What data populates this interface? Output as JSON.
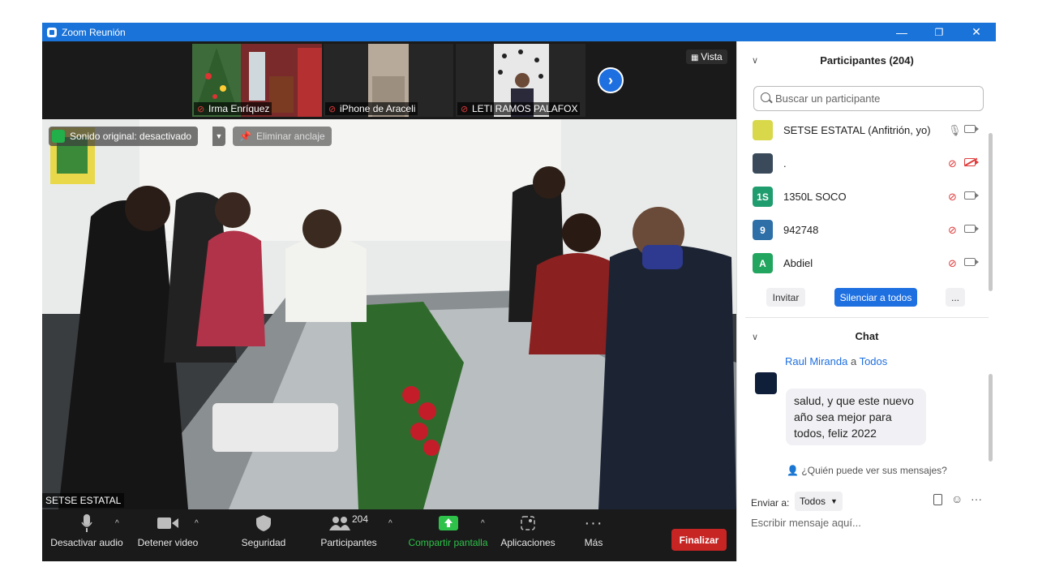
{
  "window": {
    "title": "Zoom Reunión",
    "minimize": "—",
    "restore": "❐",
    "close": "✕"
  },
  "gallery": {
    "tiles": [
      {
        "name": "Irma Enríquez"
      },
      {
        "name": "iPhone de Araceli"
      },
      {
        "name": "LETI RAMOS PALAFOX"
      }
    ],
    "view_label": "Vista"
  },
  "main_video": {
    "sound_label": "Sonido original: desactivado",
    "unpin_label": "Eliminar anclaje",
    "speaker_name": "SETSE ESTATAL"
  },
  "toolbar": {
    "mute_label": "Desactivar audio",
    "video_label": "Detener video",
    "security_label": "Seguridad",
    "participants_label": "Participantes",
    "participants_count": "204",
    "share_label": "Compartir pantalla",
    "apps_label": "Aplicaciones",
    "more_label": "Más",
    "end_label": "Finalizar"
  },
  "participants": {
    "title": "Participantes (204)",
    "search_placeholder": "Buscar un participante",
    "list": [
      {
        "name": "SETSE ESTATAL (Anfitrión, yo)",
        "initials": "",
        "color": "#d8d84a",
        "mic": "on",
        "cam": "on"
      },
      {
        "name": ".",
        "initials": "",
        "color": "#3a4a5a",
        "mic": "off",
        "cam": "off"
      },
      {
        "name": "1350L SOCO",
        "initials": "1S",
        "color": "#1f9d6e",
        "mic": "off",
        "cam": "on"
      },
      {
        "name": "942748",
        "initials": "9",
        "color": "#2e6fa8",
        "mic": "off",
        "cam": "on"
      },
      {
        "name": "Abdiel",
        "initials": "A",
        "color": "#22a55e",
        "mic": "off",
        "cam": "on"
      }
    ],
    "invite_label": "Invitar",
    "mute_all_label": "Silenciar a todos",
    "more_label": "..."
  },
  "chat": {
    "title": "Chat",
    "sender": "Raul Miranda",
    "to_word": "a",
    "recipient": "Todos",
    "message": "salud, y que este nuevo año sea mejor para todos, feliz 2022",
    "who_can_see": "¿Quién puede ver sus mensajes?",
    "send_to_label": "Enviar a:",
    "send_to_value": "Todos",
    "input_placeholder": "Escribir mensaje aquí..."
  }
}
